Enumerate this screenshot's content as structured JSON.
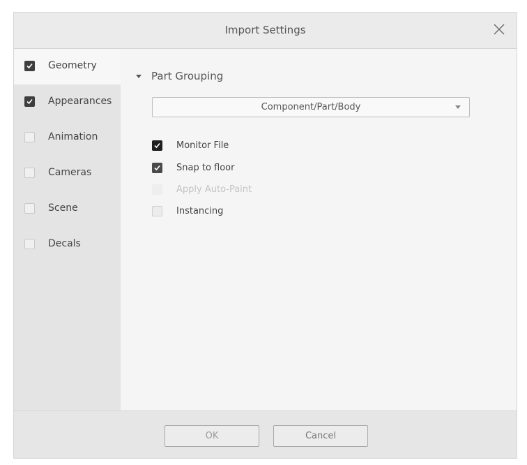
{
  "dialog": {
    "title": "Import Settings",
    "close_icon": "close-icon"
  },
  "sidebar": {
    "items": [
      {
        "label": "Geometry",
        "checked": true,
        "active": true
      },
      {
        "label": "Appearances",
        "checked": true,
        "active": false
      },
      {
        "label": "Animation",
        "checked": false,
        "active": false
      },
      {
        "label": "Cameras",
        "checked": false,
        "active": false
      },
      {
        "label": "Scene",
        "checked": false,
        "active": false
      },
      {
        "label": "Decals",
        "checked": false,
        "active": false
      }
    ]
  },
  "main": {
    "section_title": "Part Grouping",
    "grouping_value": "Component/Part/Body",
    "options": [
      {
        "label": "Monitor File",
        "checked": true,
        "disabled": false
      },
      {
        "label": "Snap to floor",
        "checked": true,
        "disabled": false
      },
      {
        "label": "Apply Auto-Paint",
        "checked": false,
        "disabled": true
      },
      {
        "label": "Instancing",
        "checked": false,
        "disabled": false
      }
    ]
  },
  "footer": {
    "ok_label": "OK",
    "cancel_label": "Cancel"
  },
  "colors": {
    "checkbox_checked": "#3e3e3e",
    "sidebar_bg": "#e4e4e4",
    "content_bg": "#f5f5f5"
  }
}
